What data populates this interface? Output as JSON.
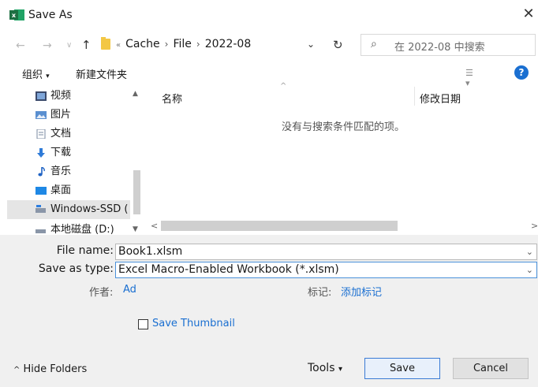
{
  "window": {
    "title": "Save As",
    "close_glyph": "✕"
  },
  "nav": {
    "back_glyph": "←",
    "forward_glyph": "→",
    "recent_glyph": "∨",
    "up_glyph": "↑",
    "path_prefix_glyph": "«",
    "path": [
      "Cache",
      "File",
      "2022-08"
    ],
    "path_separator": "›",
    "dropdown_glyph": "⌄",
    "refresh_glyph": "↻",
    "search_placeholder": "在 2022-08 中搜索"
  },
  "toolbar": {
    "organize": "组织",
    "organize_caret": "▾",
    "new_folder": "新建文件夹",
    "view_glyph": "☰ ▾",
    "help_glyph": "?"
  },
  "sidebar": {
    "items": [
      {
        "label": "视频",
        "icon": "video-icon"
      },
      {
        "label": "图片",
        "icon": "pictures-icon"
      },
      {
        "label": "文档",
        "icon": "documents-icon"
      },
      {
        "label": "下载",
        "icon": "downloads-icon"
      },
      {
        "label": "音乐",
        "icon": "music-icon"
      },
      {
        "label": "桌面",
        "icon": "desktop-icon"
      },
      {
        "label": "Windows-SSD (",
        "icon": "drive-icon",
        "selected": true
      },
      {
        "label": "本地磁盘 (D:)",
        "icon": "drive-icon"
      }
    ],
    "scroll_up_glyph": "▲",
    "scroll_down_glyph": "▼"
  },
  "filelist": {
    "col_name": "名称",
    "col_date": "修改日期",
    "sort_glyph": "^",
    "empty_message": "没有与搜索条件匹配的项。",
    "scroll_left_glyph": "<",
    "scroll_right_glyph": ">"
  },
  "form": {
    "filename_label": "File name:",
    "filename_value": "Book1.xlsm",
    "savetype_label": "Save as type:",
    "savetype_value": "Excel Macro-Enabled Workbook (*.xlsm)",
    "dropdown_glyph": "⌄",
    "author_label": "作者:",
    "author_value": "Ad",
    "tags_label": "标记:",
    "tags_value": "添加标记",
    "thumbnail_label": "Save Thumbnail"
  },
  "footer": {
    "hide_folders": "Hide Folders",
    "hide_glyph": "^",
    "tools": "Tools",
    "tools_caret": "▾",
    "save": "Save",
    "cancel": "Cancel"
  },
  "colors": {
    "accent": "#1a6fd1",
    "excel_green": "#1d6f42",
    "folder_yellow": "#f3c744"
  }
}
